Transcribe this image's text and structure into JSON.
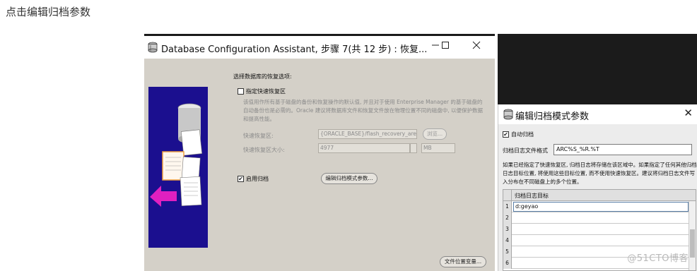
{
  "instruction": "点击编辑归档参数",
  "dbca": {
    "title": "Database Configuration Assistant, 步骤 7(共 12 步) : 恢复...",
    "minimize_icon": "minimize-icon",
    "maximize_icon": "maximize-icon",
    "close_icon": "close-icon",
    "section_title": "选择数据库的恢复选项:",
    "fast_recovery_checkbox": "指定快速恢复区",
    "description": "该值用作所有基于磁盘的备份和恢复操作的默认值, 并且对于使用 Enterprise Manager 的基于磁盘的自动备份也是必需的。Oracle 建议将数据库文件和恢复文件放在物理位置不同的磁盘中, 以便保护数据和提高性能。",
    "recovery_area_label": "快速恢复区:",
    "recovery_area_value": "{ORACLE_BASE}/flash_recovery_area",
    "browse_button": "浏览...",
    "recovery_size_label": "快速恢复区大小:",
    "recovery_size_value": "4977",
    "size_unit": "MB",
    "archive_checkbox_mark": "✔",
    "archive_checkbox": "启用归档",
    "edit_archive_button": "编辑归档模式参数...",
    "file_location_button": "文件位置变量..."
  },
  "dialog": {
    "title": "编辑归档模式参数",
    "close_glyph": "✕",
    "auto_archive_mark": "✔",
    "auto_archive_label": "自动归档",
    "format_label": "归档日志文件格式",
    "format_value": "ARC%S_%R.%T",
    "description": "如果已经指定了快速恢复区, 归档日志将存储在该区域中。如果指定了任何其他归档日志目标位置, 将使用这些目标位置, 而不使用快速恢复区。建议将归档日志文件写入分布在不同磁盘上的多个位置。",
    "table_header": "归档日志目标",
    "rows": [
      {
        "num": "1",
        "value": "d:geyao"
      },
      {
        "num": "2",
        "value": ""
      },
      {
        "num": "3",
        "value": ""
      },
      {
        "num": "4",
        "value": ""
      },
      {
        "num": "5",
        "value": ""
      },
      {
        "num": "6",
        "value": ""
      }
    ]
  },
  "watermark": "@51CTO博客",
  "colors": {
    "dbca_bg": "#d4d0c8",
    "graphic_bg": "#1b0f8f",
    "arrow": "#e020c0",
    "dark_panel": "#1b1b1b"
  }
}
